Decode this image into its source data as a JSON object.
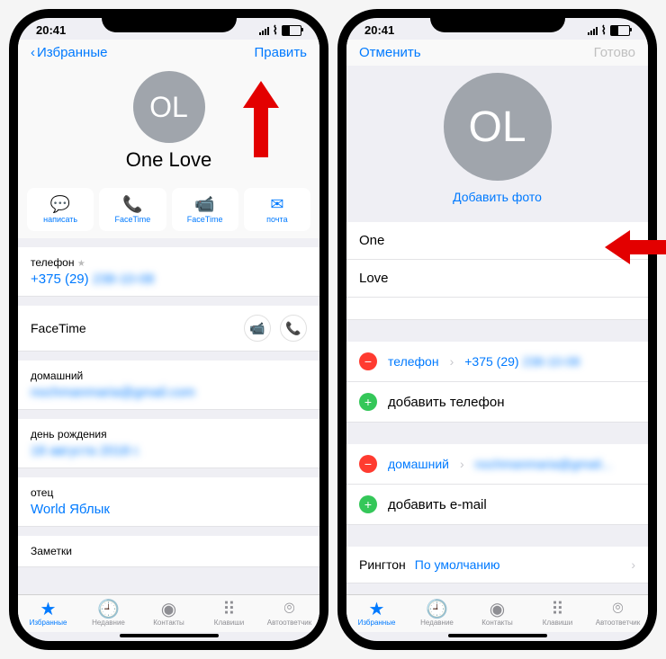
{
  "status": {
    "time": "20:41"
  },
  "left": {
    "back": "Избранные",
    "edit": "Править",
    "avatar_initials": "OL",
    "name": "One Love",
    "actions": [
      {
        "icon": "💬",
        "label": "написать"
      },
      {
        "icon": "📞",
        "label": "FaceTime"
      },
      {
        "icon": "📹",
        "label": "FaceTime"
      },
      {
        "icon": "✉",
        "label": "почта"
      }
    ],
    "phone": {
      "label": "телефон",
      "value": "+375 (29)"
    },
    "ft": {
      "label": "FaceTime"
    },
    "home": {
      "label": "домашний"
    },
    "bday": {
      "label": "день рождения"
    },
    "father": {
      "label": "отец",
      "value": "World Яблык"
    },
    "notes": {
      "label": "Заметки"
    }
  },
  "right": {
    "cancel": "Отменить",
    "done": "Готово",
    "avatar_initials": "OL",
    "add_photo": "Добавить фото",
    "first": "One",
    "last": "Love",
    "phone_row": {
      "label": "телефон",
      "value": "+375 (29)"
    },
    "add_phone": "добавить телефон",
    "home_row": {
      "label": "домашний"
    },
    "add_email": "добавить e-mail",
    "ringtone": {
      "label": "Рингтон",
      "value": "По умолчанию"
    }
  },
  "tabs": [
    {
      "icon": "★",
      "label": "Избранные"
    },
    {
      "icon": "🕘",
      "label": "Недавние"
    },
    {
      "icon": "◉",
      "label": "Контакты"
    },
    {
      "icon": "⠿",
      "label": "Клавиши"
    },
    {
      "icon": "⌾",
      "label": "Автоответчик"
    }
  ]
}
